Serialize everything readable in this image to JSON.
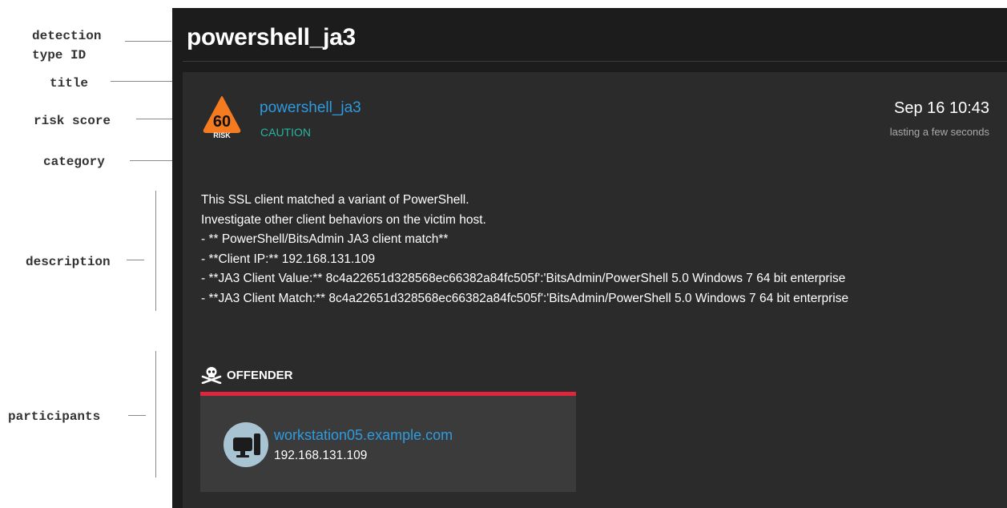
{
  "annotations": {
    "detection_type_id": "detection\ntype ID",
    "title": "title",
    "risk_score": "risk score",
    "category": "category",
    "description": "description",
    "participants": "participants"
  },
  "header": {
    "title": "powershell_ja3"
  },
  "detection": {
    "risk_score": "60",
    "risk_label": "RISK",
    "risk_color": "#f47b20",
    "title": "powershell_ja3",
    "category": "CAUTION",
    "time": "Sep 16 10:43",
    "duration": "lasting a few seconds"
  },
  "description": {
    "lines": [
      "This SSL client matched a variant of PowerShell.",
      "Investigate other client behaviors on the victim host.",
      "- ** PowerShell/BitsAdmin JA3 client match**",
      "- **Client IP:** 192.168.131.109",
      "- **JA3 Client Value:** 8c4a22651d328568ec66382a84fc505f':'BitsAdmin/PowerShell 5.0 Windows 7 64 bit enterprise",
      "- **JA3 Client Match:** 8c4a22651d328568ec66382a84fc505f':'BitsAdmin/PowerShell 5.0 Windows 7 64 bit enterprise"
    ]
  },
  "participants": {
    "role": "OFFENDER",
    "role_icon": "skull-crossbones-icon",
    "bar_color": "#e0253c",
    "hostname": "workstation05.example.com",
    "ip": "192.168.131.109",
    "device_icon": "desktop-computer-icon"
  }
}
